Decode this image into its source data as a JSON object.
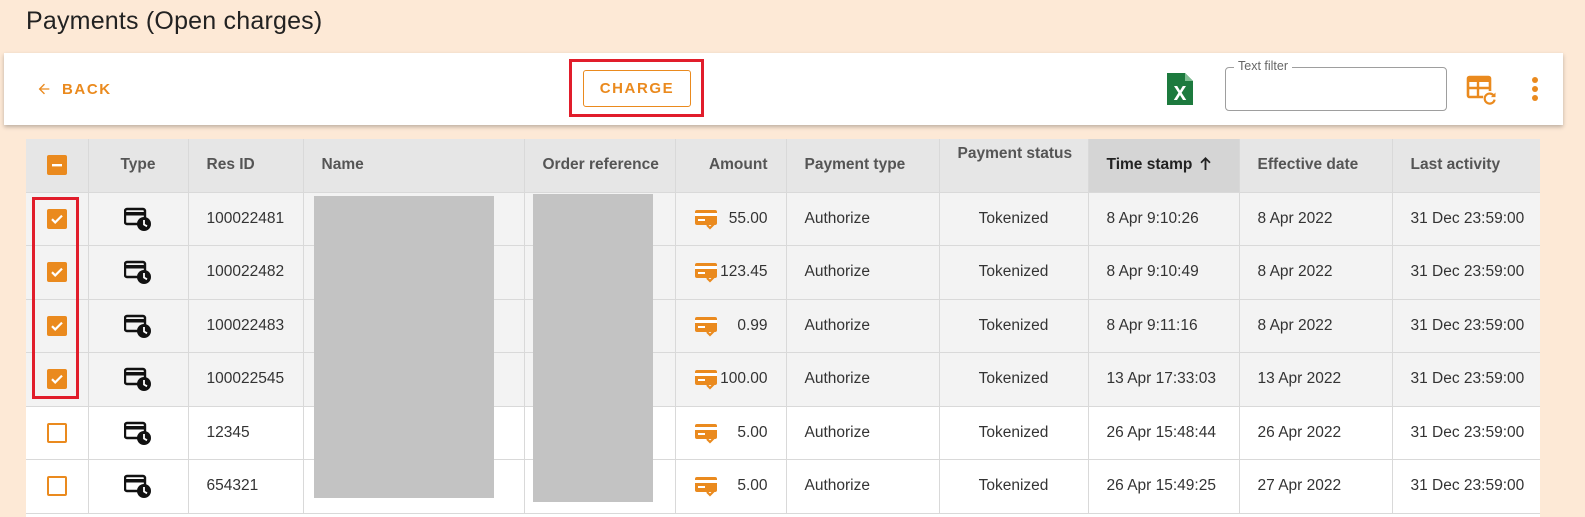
{
  "page": {
    "title": "Payments (Open charges)"
  },
  "toolbar": {
    "back_label": "BACK",
    "charge_label": "CHARGE",
    "filter_label": "Text filter",
    "filter_value": ""
  },
  "colors": {
    "accent": "#ea8a1e",
    "highlight": "#e11d2b",
    "excel": "#1d7a3e"
  },
  "icons": {
    "back": "arrow-left-icon",
    "export": "excel-icon",
    "columns": "table-refresh-icon",
    "more": "more-vert-icon",
    "type": "card-clock-icon",
    "amount": "card-check-icon"
  },
  "table": {
    "header_checkbox_state": "indeterminate",
    "columns": {
      "type": "Type",
      "res_id": "Res ID",
      "name": "Name",
      "order_ref": "Order reference",
      "amount": "Amount",
      "payment_type": "Payment type",
      "payment_status": "Payment status",
      "time_stamp": "Time stamp",
      "effective_date": "Effective date",
      "last_activity": "Last activity"
    },
    "sort": {
      "column": "time_stamp",
      "direction": "ascending"
    },
    "rows": [
      {
        "checked": true,
        "res_id": "100022481",
        "amount": "55.00",
        "payment_type": "Authorize",
        "payment_status": "Tokenized",
        "time_stamp": "8 Apr 9:10:26",
        "effective_date": "8 Apr 2022",
        "last_activity": "31 Dec 23:59:00"
      },
      {
        "checked": true,
        "res_id": "100022482",
        "amount": "123.45",
        "payment_type": "Authorize",
        "payment_status": "Tokenized",
        "time_stamp": "8 Apr 9:10:49",
        "effective_date": "8 Apr 2022",
        "last_activity": "31 Dec 23:59:00"
      },
      {
        "checked": true,
        "res_id": "100022483",
        "amount": "0.99",
        "payment_type": "Authorize",
        "payment_status": "Tokenized",
        "time_stamp": "8 Apr 9:11:16",
        "effective_date": "8 Apr 2022",
        "last_activity": "31 Dec 23:59:00"
      },
      {
        "checked": true,
        "res_id": "100022545",
        "amount": "100.00",
        "payment_type": "Authorize",
        "payment_status": "Tokenized",
        "time_stamp": "13 Apr 17:33:03",
        "effective_date": "13 Apr 2022",
        "last_activity": "31 Dec 23:59:00"
      },
      {
        "checked": false,
        "res_id": "12345",
        "amount": "5.00",
        "payment_type": "Authorize",
        "payment_status": "Tokenized",
        "time_stamp": "26 Apr 15:48:44",
        "effective_date": "26 Apr 2022",
        "last_activity": "31 Dec 23:59:00"
      },
      {
        "checked": false,
        "res_id": "654321",
        "amount": "5.00",
        "payment_type": "Authorize",
        "payment_status": "Tokenized",
        "time_stamp": "26 Apr 15:49:25",
        "effective_date": "27 Apr 2022",
        "last_activity": "31 Dec 23:59:00"
      }
    ]
  }
}
